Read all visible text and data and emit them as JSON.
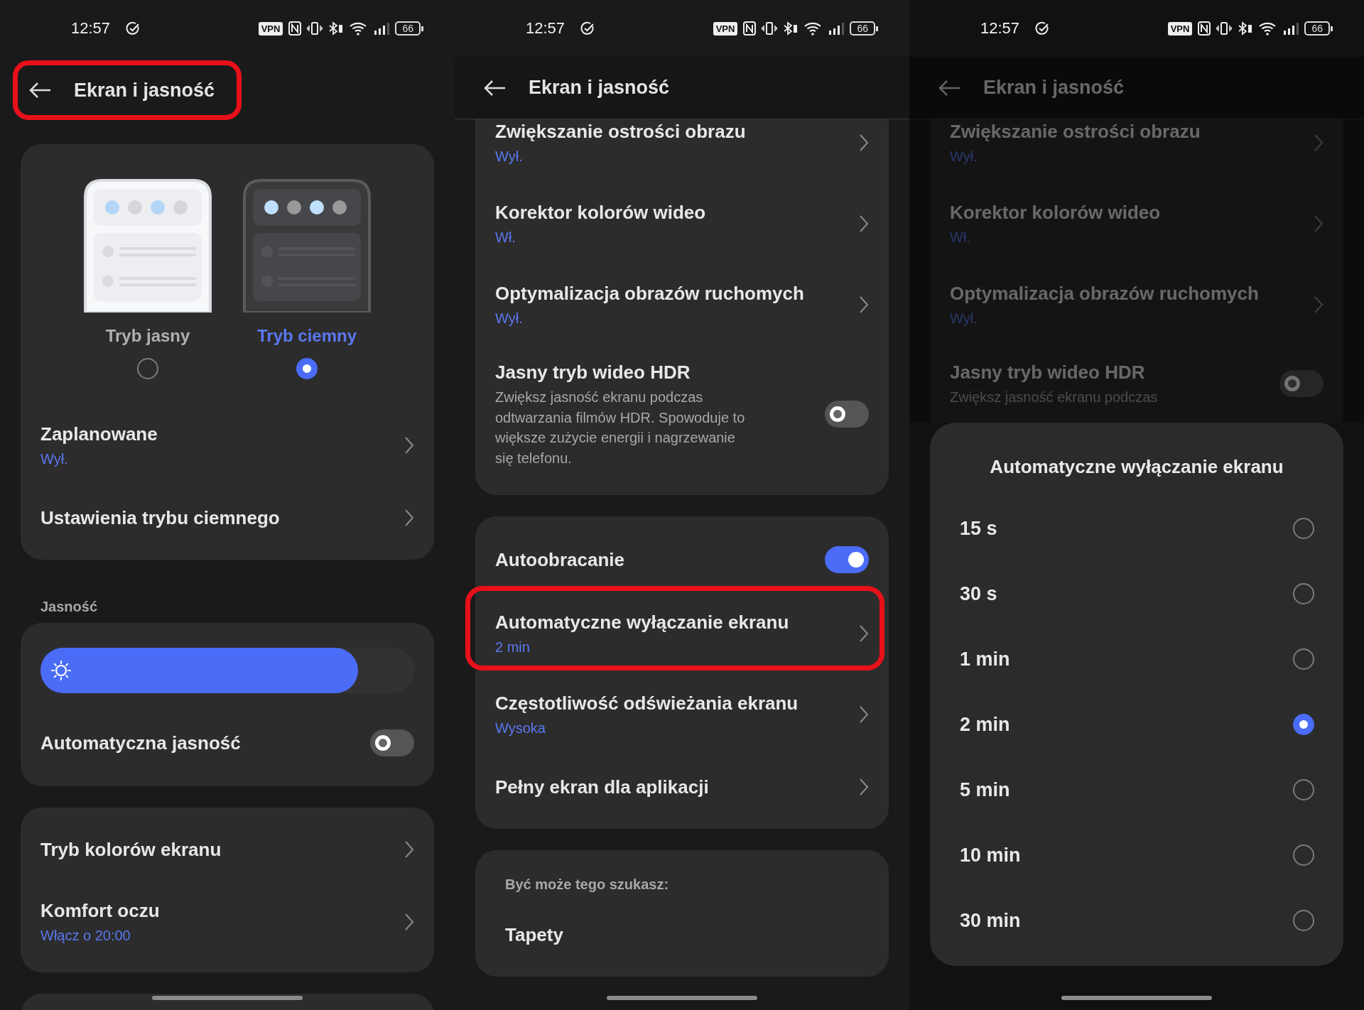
{
  "screens": [
    {
      "status_bar": {
        "time": "12:57",
        "vpn": "VPN",
        "battery": "66"
      },
      "header": {
        "title": "Ekran i jasność",
        "highlighted": true
      },
      "sections": [
        {
          "kind": "card",
          "clipped_top": false,
          "rows": [
            {
              "kind": "theme_picker",
              "options": [
                {
                  "label": "Tryb jasny",
                  "selected": false
                },
                {
                  "label": "Tryb ciemny",
                  "selected": true
                }
              ]
            },
            {
              "kind": "link",
              "title": "Zaplanowane",
              "value": "Wył.",
              "highlighted": false
            },
            {
              "kind": "link",
              "title": "Ustawienia trybu ciemnego",
              "highlighted": false
            }
          ]
        },
        {
          "kind": "label",
          "text": "Jasność"
        },
        {
          "kind": "card",
          "clipped_top": false,
          "rows": [
            {
              "kind": "slider",
              "level": 0.85
            },
            {
              "kind": "toggle",
              "title": "Automatyczna jasność",
              "on": false
            }
          ]
        },
        {
          "kind": "card",
          "clipped_top": false,
          "rows": [
            {
              "kind": "link",
              "title": "Tryb kolorów ekranu",
              "highlighted": false
            },
            {
              "kind": "link",
              "title": "Komfort oczu",
              "value": "Włącz o 20:00",
              "highlighted": false
            }
          ]
        },
        {
          "kind": "peek"
        }
      ]
    },
    {
      "status_bar": {
        "time": "12:57",
        "vpn": "VPN",
        "battery": "66"
      },
      "header": {
        "title": "Ekran i jasność",
        "highlighted": false
      },
      "sections": [
        {
          "kind": "card",
          "clipped_top": true,
          "rows": [
            {
              "kind": "link",
              "title": "Zwiększanie ostrości obrazu",
              "value": "Wył.",
              "highlighted": false
            },
            {
              "kind": "link",
              "title": "Korektor kolorów wideo",
              "value": "Wł.",
              "highlighted": false
            },
            {
              "kind": "link",
              "title": "Optymalizacja obrazów ruchomych",
              "value": "Wył.",
              "highlighted": false
            },
            {
              "kind": "toggle",
              "title": "Jasny tryb wideo HDR",
              "description": "Zwiększ jasność ekranu podczas odtwarzania filmów HDR. Spowoduje to większe zużycie energii i nagrzewanie się telefonu.",
              "on": false
            }
          ]
        },
        {
          "kind": "card",
          "clipped_top": false,
          "rows": [
            {
              "kind": "toggle",
              "title": "Autoobracanie",
              "on": true
            },
            {
              "kind": "link",
              "title": "Automatyczne wyłączanie ekranu",
              "value": "2 min",
              "highlighted": true
            },
            {
              "kind": "link",
              "title": "Częstotliwość odświeżania ekranu",
              "value": "Wysoka",
              "highlighted": false
            },
            {
              "kind": "link",
              "title": "Pełny ekran dla aplikacji",
              "highlighted": false
            }
          ]
        },
        {
          "kind": "card",
          "clipped_top": false,
          "rows": [
            {
              "kind": "heading",
              "text": "Być może tego szukasz:"
            },
            {
              "kind": "plain",
              "title": "Tapety"
            }
          ]
        }
      ]
    },
    {
      "status_bar": {
        "time": "12:57",
        "vpn": "VPN",
        "battery": "66"
      },
      "header": {
        "title": "Ekran i jasność",
        "highlighted": false
      },
      "sections": [
        {
          "kind": "card",
          "clipped_top": true,
          "rows": [
            {
              "kind": "link",
              "title": "Zwiększanie ostrości obrazu",
              "value": "Wył.",
              "highlighted": false
            },
            {
              "kind": "link",
              "title": "Korektor kolorów wideo",
              "value": "Wł.",
              "highlighted": false
            },
            {
              "kind": "link",
              "title": "Optymalizacja obrazów ruchomych",
              "value": "Wył.",
              "highlighted": false
            },
            {
              "kind": "toggle",
              "title": "Jasny tryb wideo HDR",
              "description": "Zwiększ jasność ekranu podczas",
              "on": false
            }
          ]
        }
      ],
      "sheet": {
        "title": "Automatyczne wyłączanie ekranu",
        "options": [
          {
            "label": "15 s",
            "selected": false
          },
          {
            "label": "30 s",
            "selected": false
          },
          {
            "label": "1 min",
            "selected": false
          },
          {
            "label": "2 min",
            "selected": true
          },
          {
            "label": "5 min",
            "selected": false
          },
          {
            "label": "10 min",
            "selected": false
          },
          {
            "label": "30 min",
            "selected": false
          }
        ]
      }
    }
  ]
}
